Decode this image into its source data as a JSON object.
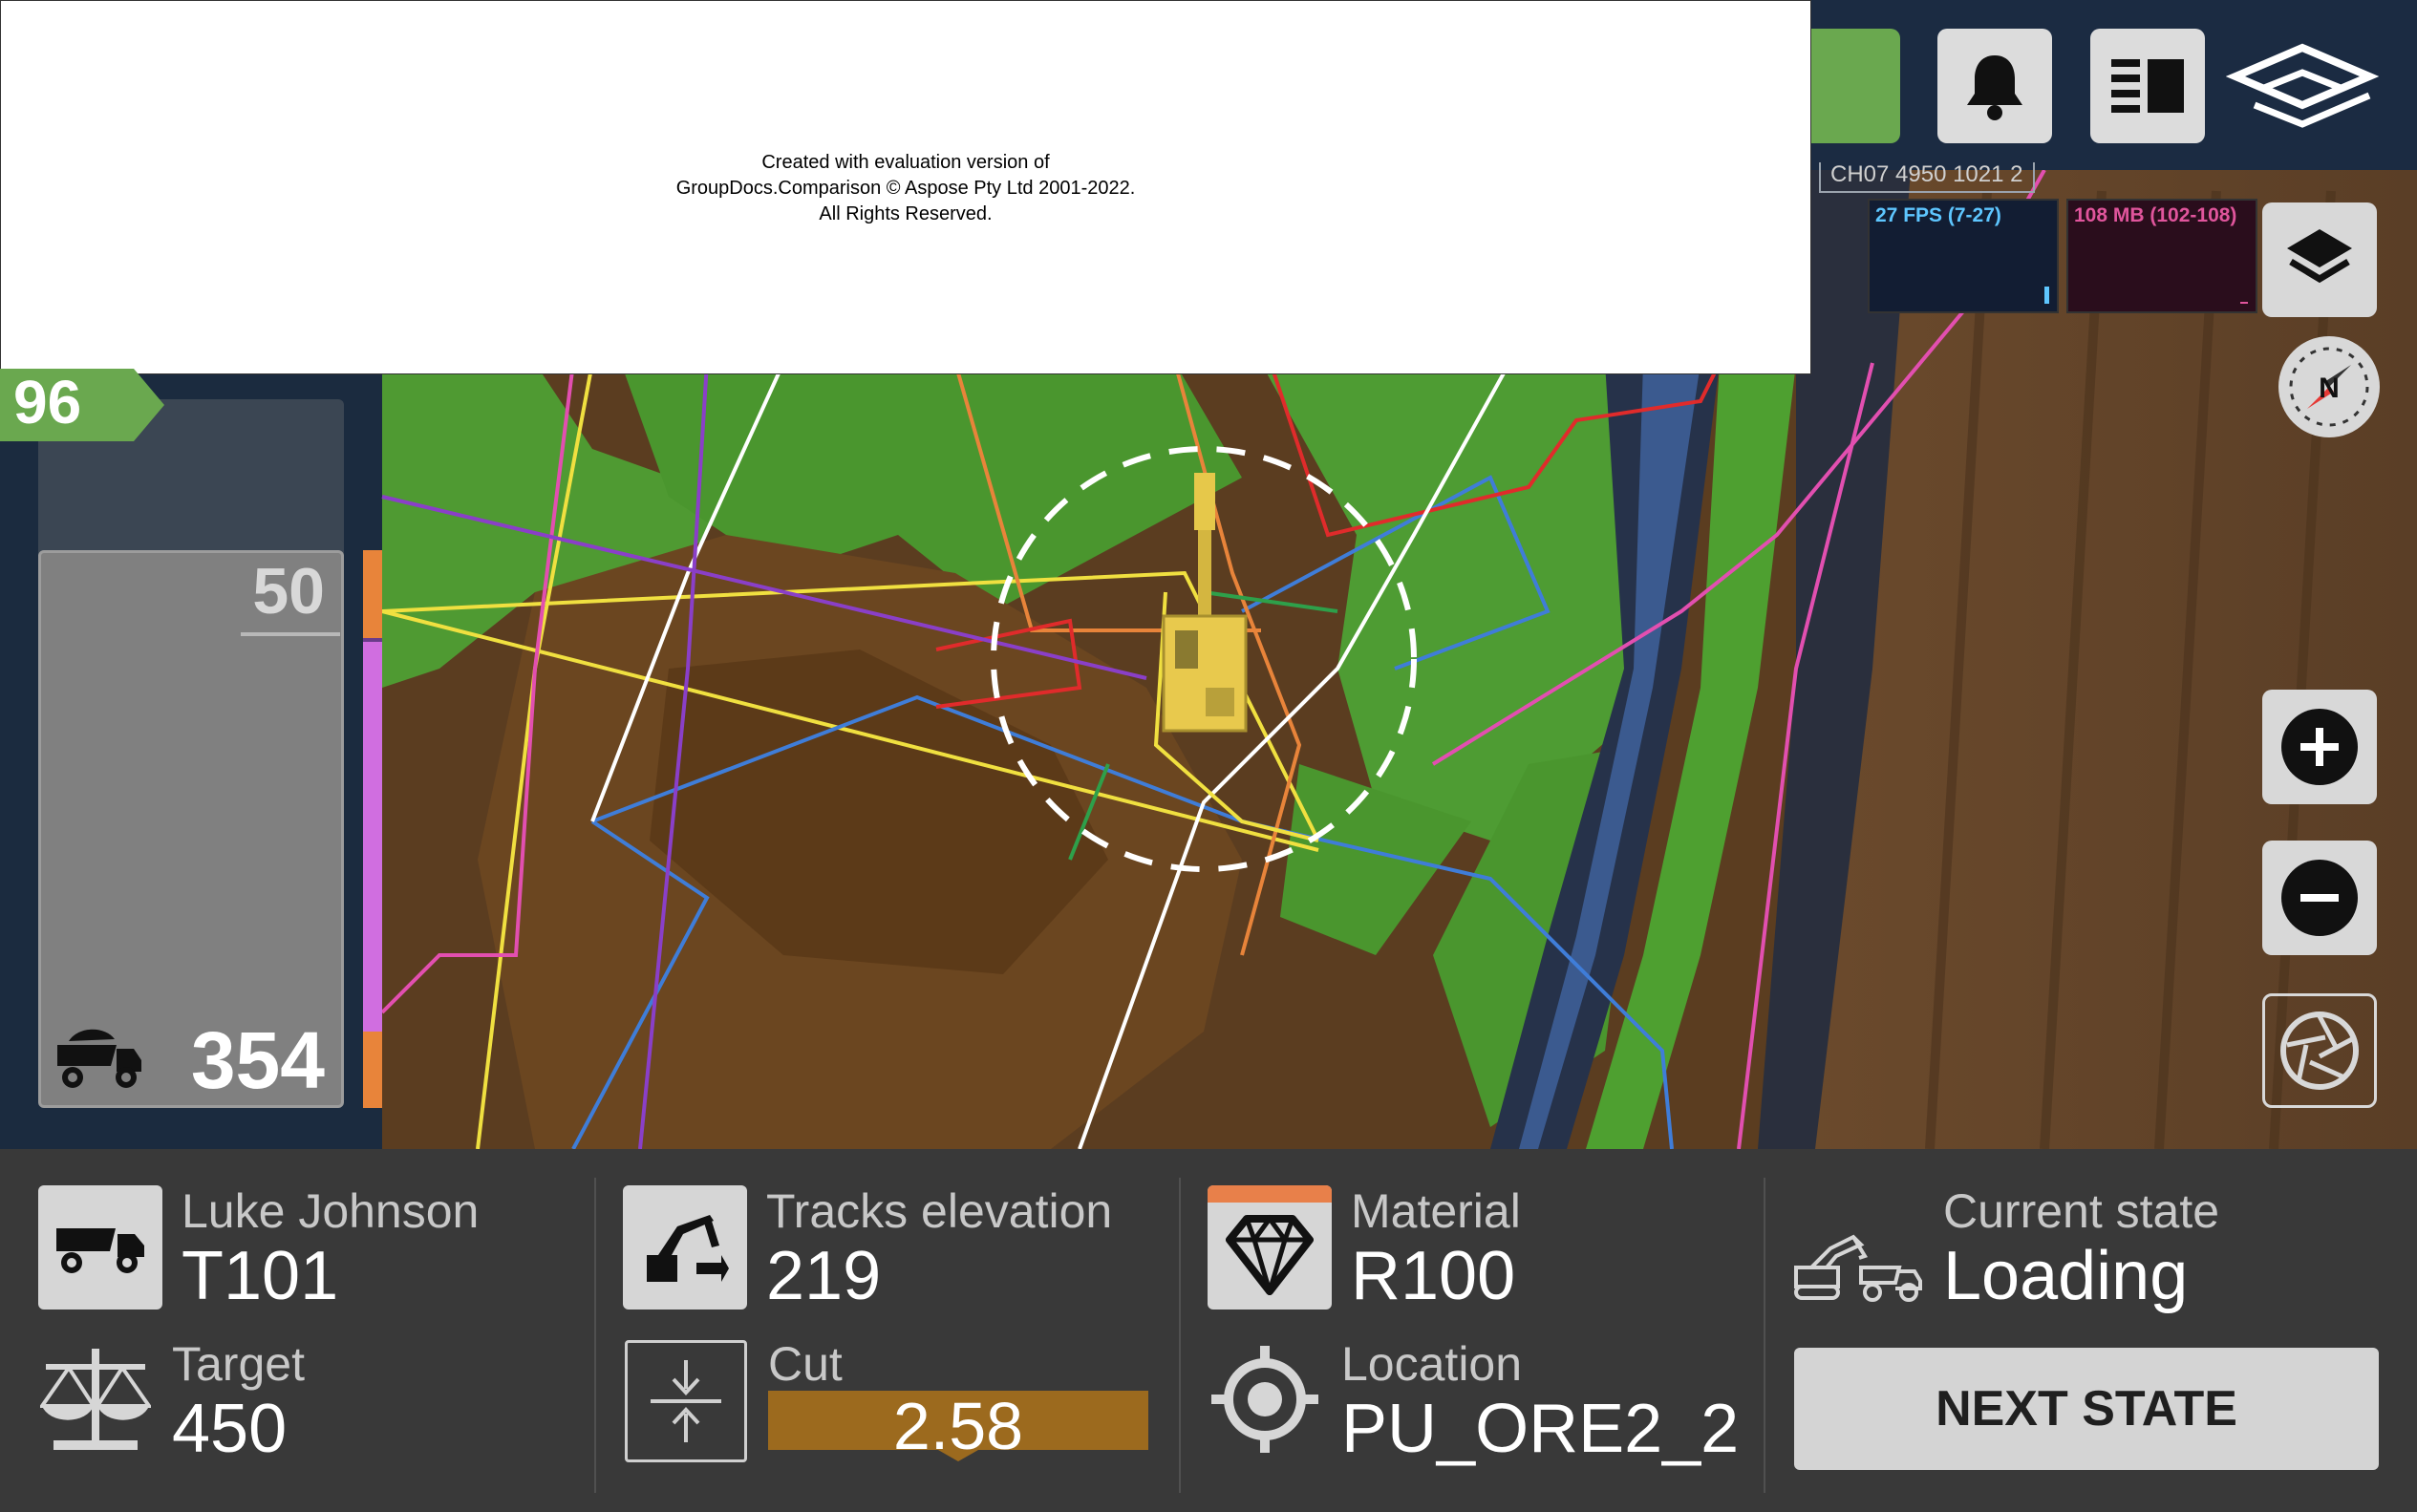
{
  "watermark": {
    "line1": "Created with evaluation version of",
    "line2": "GroupDocs.Comparison © Aspose Pty Ltd 2001-2022.",
    "line3": "All Rights Reserved."
  },
  "map": {
    "ch_label": "CH07 4950 1021 2",
    "fps_label": "27 FPS (7-27)",
    "mem_label": "108 MB (102-108)"
  },
  "left_panel": {
    "badge": "96",
    "max": "50",
    "count": "354",
    "badge_color": "#6aa84f"
  },
  "bottom": {
    "truck": {
      "operator": "Luke Johnson",
      "id": "T101"
    },
    "target": {
      "label": "Target",
      "value": "450"
    },
    "tracks": {
      "label": "Tracks elevation",
      "value": "219"
    },
    "cut": {
      "label": "Cut",
      "value": "2.58",
      "color": "#9c6a1e"
    },
    "material": {
      "label": "Material",
      "value": "R100",
      "accent": "#e8804a"
    },
    "location": {
      "label": "Location",
      "value": "PU_ORE2_2"
    },
    "state": {
      "label": "Current state",
      "value": "Loading",
      "button": "NEXT STATE"
    }
  },
  "icons": {
    "bell": "bell-icon",
    "panel": "panel-layout-icon",
    "logo": "brand-logo-icon",
    "layers": "layers-icon",
    "compass": "compass-icon",
    "zoom_in": "plus-icon",
    "zoom_out": "minus-icon",
    "camera": "aperture-icon"
  }
}
